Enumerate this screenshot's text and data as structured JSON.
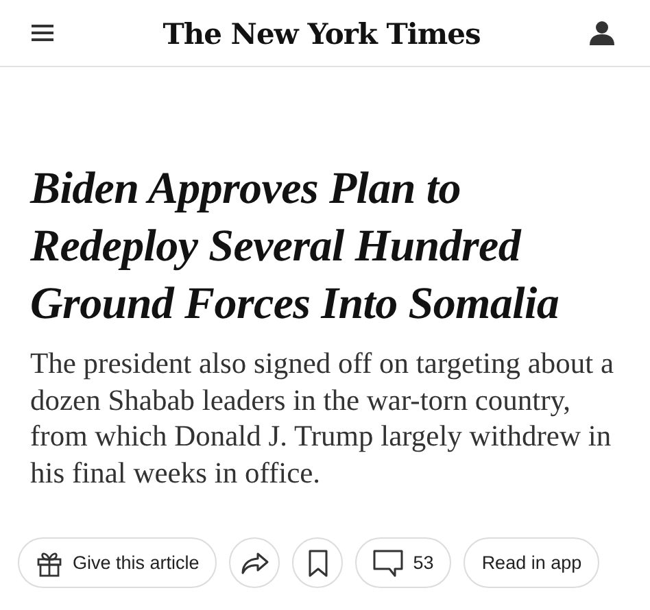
{
  "header": {
    "logo": "The New York Times"
  },
  "article": {
    "headline": "Biden Approves Plan to Redeploy Several Hundred Ground Forces Into Somalia",
    "summary": "The president also signed off on targeting about a dozen Shabab leaders in the war-torn country, from which Donald J. Trump largely withdrew in his final weeks in office."
  },
  "actions": [
    {
      "kind": "gift",
      "label": "Give this article"
    },
    {
      "kind": "share"
    },
    {
      "kind": "bookmark"
    },
    {
      "kind": "comments",
      "label": "53"
    },
    {
      "kind": "text",
      "label": "Read in app"
    }
  ]
}
